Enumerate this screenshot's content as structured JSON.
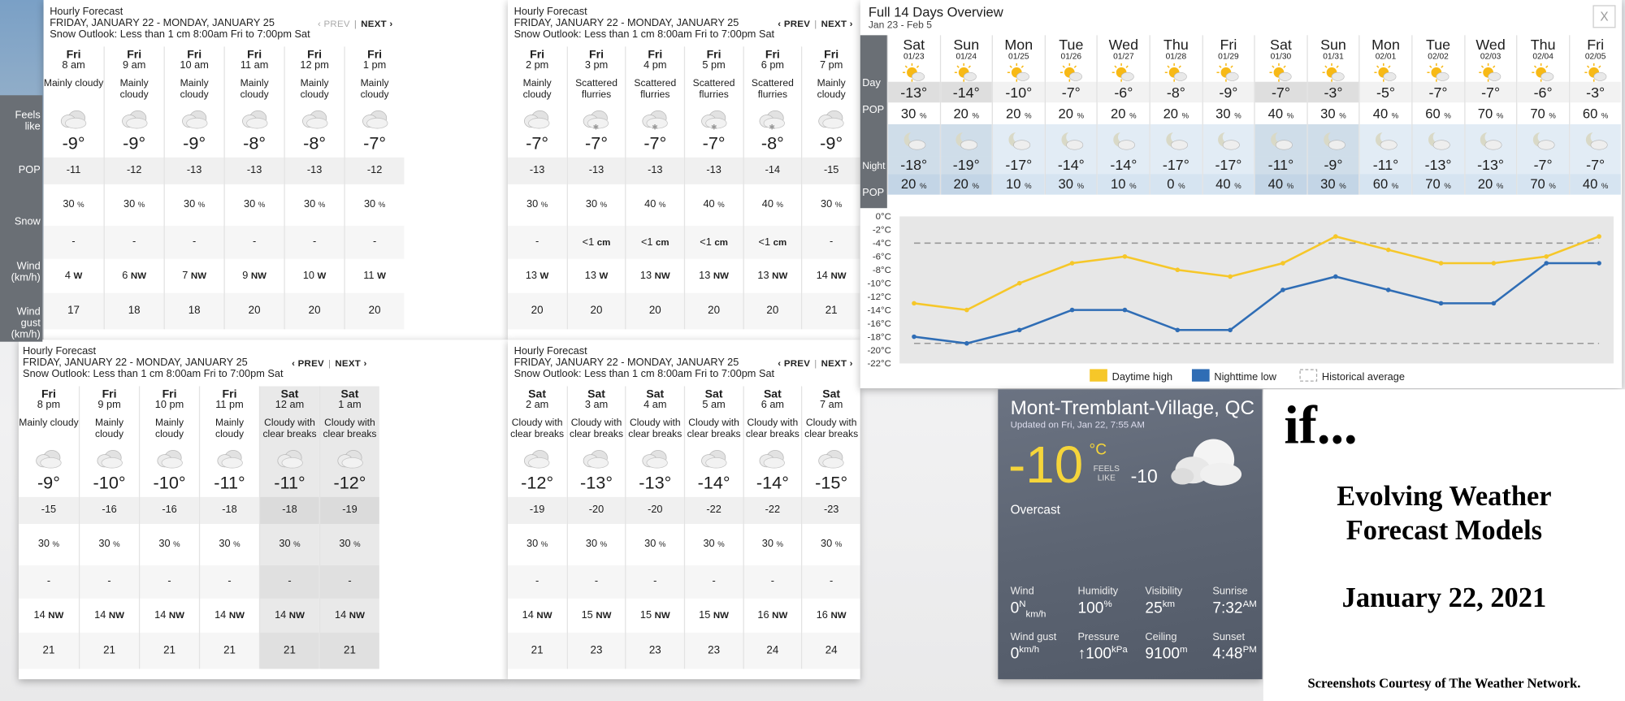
{
  "hourly_header": {
    "title": "Hourly Forecast",
    "range": "FRIDAY, JANUARY 22 - MONDAY, JANUARY 25",
    "outlook": "Snow Outlook: Less than 1 cm 8:00am Fri to 7:00pm Sat",
    "prev": "‹ PREV",
    "next": "NEXT ›",
    "sep": "|"
  },
  "row_labels": {
    "feels": "Feels like",
    "pop": "POP",
    "snow": "Snow",
    "wind": "Wind (km/h)",
    "gust": "Wind gust (km/h)"
  },
  "panels": [
    {
      "hours": [
        {
          "day": "Fri",
          "time": "8 am",
          "cond": "Mainly cloudy",
          "temp": "-9°",
          "feels": "-11",
          "pop": "30",
          "snow": "-",
          "wind": "4",
          "dir": "W",
          "gust": "17"
        },
        {
          "day": "Fri",
          "time": "9 am",
          "cond": "Mainly cloudy",
          "temp": "-9°",
          "feels": "-12",
          "pop": "30",
          "snow": "-",
          "wind": "6",
          "dir": "NW",
          "gust": "18"
        },
        {
          "day": "Fri",
          "time": "10 am",
          "cond": "Mainly cloudy",
          "temp": "-9°",
          "feels": "-13",
          "pop": "30",
          "snow": "-",
          "wind": "7",
          "dir": "NW",
          "gust": "18"
        },
        {
          "day": "Fri",
          "time": "11 am",
          "cond": "Mainly cloudy",
          "temp": "-8°",
          "feels": "-13",
          "pop": "30",
          "snow": "-",
          "wind": "9",
          "dir": "NW",
          "gust": "20"
        },
        {
          "day": "Fri",
          "time": "12 pm",
          "cond": "Mainly cloudy",
          "temp": "-8°",
          "feels": "-13",
          "pop": "30",
          "snow": "-",
          "wind": "10",
          "dir": "W",
          "gust": "20"
        },
        {
          "day": "Fri",
          "time": "1 pm",
          "cond": "Mainly cloudy",
          "temp": "-7°",
          "feels": "-12",
          "pop": "30",
          "snow": "-",
          "wind": "11",
          "dir": "W",
          "gust": "20"
        }
      ]
    },
    {
      "hours": [
        {
          "day": "Fri",
          "time": "2 pm",
          "cond": "Mainly cloudy",
          "temp": "-7°",
          "feels": "-13",
          "pop": "30",
          "snow": "-",
          "wind": "13",
          "dir": "W",
          "gust": "20"
        },
        {
          "day": "Fri",
          "time": "3 pm",
          "cond": "Scattered flurries",
          "temp": "-7°",
          "feels": "-13",
          "pop": "30",
          "snow": "<1",
          "wind": "13",
          "dir": "W",
          "gust": "20"
        },
        {
          "day": "Fri",
          "time": "4 pm",
          "cond": "Scattered flurries",
          "temp": "-7°",
          "feels": "-13",
          "pop": "40",
          "snow": "<1",
          "wind": "13",
          "dir": "NW",
          "gust": "20"
        },
        {
          "day": "Fri",
          "time": "5 pm",
          "cond": "Scattered flurries",
          "temp": "-7°",
          "feels": "-13",
          "pop": "40",
          "snow": "<1",
          "wind": "13",
          "dir": "NW",
          "gust": "20"
        },
        {
          "day": "Fri",
          "time": "6 pm",
          "cond": "Scattered flurries",
          "temp": "-8°",
          "feels": "-14",
          "pop": "40",
          "snow": "<1",
          "wind": "13",
          "dir": "NW",
          "gust": "20"
        },
        {
          "day": "Fri",
          "time": "7 pm",
          "cond": "Mainly cloudy",
          "temp": "-9°",
          "feels": "-15",
          "pop": "30",
          "snow": "-",
          "wind": "14",
          "dir": "NW",
          "gust": "21"
        }
      ]
    },
    {
      "hours": [
        {
          "day": "Fri",
          "time": "8 pm",
          "cond": "Mainly cloudy",
          "temp": "-9°",
          "feels": "-15",
          "pop": "30",
          "snow": "-",
          "wind": "14",
          "dir": "NW",
          "gust": "21"
        },
        {
          "day": "Fri",
          "time": "9 pm",
          "cond": "Mainly cloudy",
          "temp": "-10°",
          "feels": "-16",
          "pop": "30",
          "snow": "-",
          "wind": "14",
          "dir": "NW",
          "gust": "21"
        },
        {
          "day": "Fri",
          "time": "10 pm",
          "cond": "Mainly cloudy",
          "temp": "-10°",
          "feels": "-16",
          "pop": "30",
          "snow": "-",
          "wind": "14",
          "dir": "NW",
          "gust": "21"
        },
        {
          "day": "Fri",
          "time": "11 pm",
          "cond": "Mainly cloudy",
          "temp": "-11°",
          "feels": "-18",
          "pop": "30",
          "snow": "-",
          "wind": "14",
          "dir": "NW",
          "gust": "21"
        },
        {
          "day": "Sat",
          "time": "12 am",
          "cond": "Cloudy with clear breaks",
          "temp": "-11°",
          "feels": "-18",
          "pop": "30",
          "snow": "-",
          "wind": "14",
          "dir": "NW",
          "gust": "21"
        },
        {
          "day": "Sat",
          "time": "1 am",
          "cond": "Cloudy with clear breaks",
          "temp": "-12°",
          "feels": "-19",
          "pop": "30",
          "snow": "-",
          "wind": "14",
          "dir": "NW",
          "gust": "21"
        }
      ]
    },
    {
      "hours": [
        {
          "day": "Sat",
          "time": "2 am",
          "cond": "Cloudy with clear breaks",
          "temp": "-12°",
          "feels": "-19",
          "pop": "30",
          "snow": "-",
          "wind": "14",
          "dir": "NW",
          "gust": "21"
        },
        {
          "day": "Sat",
          "time": "3 am",
          "cond": "Cloudy with clear breaks",
          "temp": "-13°",
          "feels": "-20",
          "pop": "30",
          "snow": "-",
          "wind": "15",
          "dir": "NW",
          "gust": "23"
        },
        {
          "day": "Sat",
          "time": "4 am",
          "cond": "Cloudy with clear breaks",
          "temp": "-13°",
          "feels": "-20",
          "pop": "30",
          "snow": "-",
          "wind": "15",
          "dir": "NW",
          "gust": "23"
        },
        {
          "day": "Sat",
          "time": "5 am",
          "cond": "Cloudy with clear breaks",
          "temp": "-14°",
          "feels": "-22",
          "pop": "30",
          "snow": "-",
          "wind": "15",
          "dir": "NW",
          "gust": "23"
        },
        {
          "day": "Sat",
          "time": "6 am",
          "cond": "Cloudy with clear breaks",
          "temp": "-14°",
          "feels": "-22",
          "pop": "30",
          "snow": "-",
          "wind": "16",
          "dir": "NW",
          "gust": "24"
        },
        {
          "day": "Sat",
          "time": "7 am",
          "cond": "Cloudy with clear breaks",
          "temp": "-15°",
          "feels": "-23",
          "pop": "30",
          "snow": "-",
          "wind": "16",
          "dir": "NW",
          "gust": "24"
        }
      ]
    }
  ],
  "units": {
    "pct": "%",
    "cm": "cm",
    "deg": "°C"
  },
  "fourteen": {
    "title": "Full 14 Days Overview",
    "range": "Jan 23 - Feb 5",
    "close": "X",
    "labels": {
      "day": "Day",
      "pop": "POP",
      "night": "Night"
    },
    "days": [
      {
        "d": "Sat",
        "date": "01/23",
        "hi": "-13°",
        "pop": "30",
        "lo": "-18°",
        "npop": "20",
        "wk": true
      },
      {
        "d": "Sun",
        "date": "01/24",
        "hi": "-14°",
        "pop": "20",
        "lo": "-19°",
        "npop": "20",
        "wk": true
      },
      {
        "d": "Mon",
        "date": "01/25",
        "hi": "-10°",
        "pop": "20",
        "lo": "-17°",
        "npop": "10",
        "wk": false
      },
      {
        "d": "Tue",
        "date": "01/26",
        "hi": "-7°",
        "pop": "20",
        "lo": "-14°",
        "npop": "30",
        "wk": false
      },
      {
        "d": "Wed",
        "date": "01/27",
        "hi": "-6°",
        "pop": "20",
        "lo": "-14°",
        "npop": "10",
        "wk": false
      },
      {
        "d": "Thu",
        "date": "01/28",
        "hi": "-8°",
        "pop": "20",
        "lo": "-17°",
        "npop": "0",
        "wk": false
      },
      {
        "d": "Fri",
        "date": "01/29",
        "hi": "-9°",
        "pop": "30",
        "lo": "-17°",
        "npop": "40",
        "wk": false
      },
      {
        "d": "Sat",
        "date": "01/30",
        "hi": "-7°",
        "pop": "40",
        "lo": "-11°",
        "npop": "40",
        "wk": true
      },
      {
        "d": "Sun",
        "date": "01/31",
        "hi": "-3°",
        "pop": "30",
        "lo": "-9°",
        "npop": "30",
        "wk": true
      },
      {
        "d": "Mon",
        "date": "02/01",
        "hi": "-5°",
        "pop": "40",
        "lo": "-11°",
        "npop": "60",
        "wk": false
      },
      {
        "d": "Tue",
        "date": "02/02",
        "hi": "-7°",
        "pop": "60",
        "lo": "-13°",
        "npop": "70",
        "wk": false
      },
      {
        "d": "Wed",
        "date": "02/03",
        "hi": "-7°",
        "pop": "70",
        "lo": "-13°",
        "npop": "20",
        "wk": false
      },
      {
        "d": "Thu",
        "date": "02/04",
        "hi": "-6°",
        "pop": "70",
        "lo": "-7°",
        "npop": "70",
        "wk": false
      },
      {
        "d": "Fri",
        "date": "02/05",
        "hi": "-3°",
        "pop": "60",
        "lo": "-7°",
        "npop": "40",
        "wk": false
      }
    ]
  },
  "chart_data": {
    "type": "line",
    "x": [
      "01/23",
      "01/24",
      "01/25",
      "01/26",
      "01/27",
      "01/28",
      "01/29",
      "01/30",
      "01/31",
      "02/01",
      "02/02",
      "02/03",
      "02/04",
      "02/05"
    ],
    "series": [
      {
        "name": "Daytime high",
        "color": "#f6c729",
        "values": [
          -13,
          -14,
          -10,
          -7,
          -6,
          -8,
          -9,
          -7,
          -3,
          -5,
          -7,
          -7,
          -6,
          -3
        ]
      },
      {
        "name": "Nighttime low",
        "color": "#2f6db5",
        "values": [
          -18,
          -19,
          -17,
          -14,
          -14,
          -17,
          -17,
          -11,
          -9,
          -11,
          -13,
          -13,
          -7,
          -7
        ]
      },
      {
        "name": "Historical average",
        "color": "#999999",
        "values": [
          -4,
          -4,
          -4,
          -4,
          -4,
          -4,
          -4,
          -4,
          -4,
          -4,
          -4,
          -4,
          -4,
          -4
        ],
        "values_low": [
          -19,
          -19,
          -19,
          -19,
          -19,
          -19,
          -19,
          -19,
          -19,
          -19,
          -19,
          -19,
          -19,
          -19
        ]
      }
    ],
    "ylim": [
      -22,
      0
    ],
    "yticks": [
      "0°C",
      "-2°C",
      "-4°C",
      "-6°C",
      "-8°C",
      "-10°C",
      "-12°C",
      "-14°C",
      "-16°C",
      "-18°C",
      "-20°C",
      "-22°C"
    ],
    "legend": "bottom"
  },
  "current": {
    "location": "Mont-Tremblant-Village, QC",
    "updated": "Updated on Fri, Jan 22, 7:55 AM",
    "temp": "-10",
    "unit": "°C",
    "feels_label1": "FEELS",
    "feels_label2": "LIKE",
    "feels": "-10",
    "condition": "Overcast",
    "stats": [
      {
        "label": "Wind",
        "value": "0",
        "sup": "N",
        "sub": "km/h"
      },
      {
        "label": "Humidity",
        "value": "100",
        "sup": "%",
        "sub": ""
      },
      {
        "label": "Visibility",
        "value": "25",
        "sup": "km",
        "sub": ""
      },
      {
        "label": "Sunrise",
        "value": "7:32",
        "sup": "AM",
        "sub": ""
      },
      {
        "label": "Wind gust",
        "value": "0",
        "sup": "km/h",
        "sub": ""
      },
      {
        "label": "Pressure",
        "value": "↑100",
        "sup": "kPa",
        "sub": ""
      },
      {
        "label": "Ceiling",
        "value": "9100",
        "sup": "m",
        "sub": ""
      },
      {
        "label": "Sunset",
        "value": "4:48",
        "sup": "PM",
        "sub": ""
      }
    ]
  },
  "caption": {
    "if": "if...",
    "line1": "Evolving Weather",
    "line2": "Forecast Models",
    "date": "January 22, 2021",
    "credit": "Screenshots Courtesy of The Weather Network."
  }
}
